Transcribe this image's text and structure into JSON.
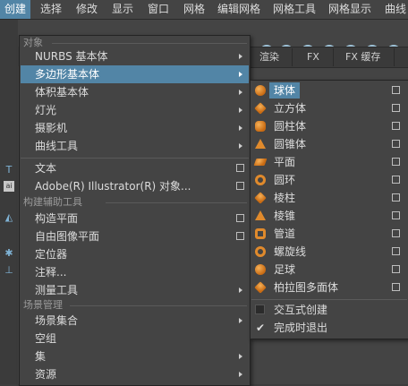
{
  "menubar": {
    "items": [
      "创建",
      "选择",
      "修改",
      "显示",
      "窗口",
      "网格",
      "编辑网格",
      "网格工具",
      "网格显示",
      "曲线"
    ]
  },
  "background": {
    "tabs": [
      "渲染",
      "FX",
      "FX 缓存"
    ]
  },
  "main_menu": {
    "sections": {
      "objects": "对象",
      "construction": "构建辅助工具",
      "scene": "场景管理"
    },
    "items": [
      {
        "label": "NURBS 基本体",
        "submenu": true
      },
      {
        "label": "多边形基本体",
        "submenu": true
      },
      {
        "label": "体积基本体",
        "submenu": true
      },
      {
        "label": "灯光",
        "submenu": true
      },
      {
        "label": "摄影机",
        "submenu": true
      },
      {
        "label": "曲线工具",
        "submenu": true
      },
      {
        "label": "文本",
        "option": true
      },
      {
        "label": "Adobe(R) Illustrator(R) 对象...",
        "option": true
      },
      {
        "label": "构造平面",
        "option": true
      },
      {
        "label": "自由图像平面",
        "option": true
      },
      {
        "label": "定位器"
      },
      {
        "label": "注释..."
      },
      {
        "label": "测量工具",
        "submenu": true
      },
      {
        "label": "场景集合",
        "submenu": true
      },
      {
        "label": "空组"
      },
      {
        "label": "集",
        "submenu": true
      },
      {
        "label": "资源",
        "submenu": true
      }
    ]
  },
  "sub_menu": {
    "items": [
      {
        "label": "球体",
        "icon": "sphere-icon"
      },
      {
        "label": "立方体",
        "icon": "cube-icon"
      },
      {
        "label": "圆柱体",
        "icon": "cylinder-icon"
      },
      {
        "label": "圆锥体",
        "icon": "cone-icon"
      },
      {
        "label": "平面",
        "icon": "plane-icon"
      },
      {
        "label": "圆环",
        "icon": "torus-icon"
      },
      {
        "label": "棱柱",
        "icon": "prism-icon"
      },
      {
        "label": "棱锥",
        "icon": "pyramid-icon"
      },
      {
        "label": "管道",
        "icon": "pipe-icon"
      },
      {
        "label": "螺旋线",
        "icon": "helix-icon"
      },
      {
        "label": "足球",
        "icon": "soccer-ball-icon"
      },
      {
        "label": "柏拉图多面体",
        "icon": "platonic-solid-icon"
      }
    ],
    "toggles": [
      {
        "label": "交互式创建",
        "checked": false
      },
      {
        "label": "完成时退出",
        "checked": true
      }
    ]
  },
  "colors": {
    "highlight": "#5285a6",
    "menu_bg": "#444444",
    "icon_orange": "#e08a2c"
  }
}
